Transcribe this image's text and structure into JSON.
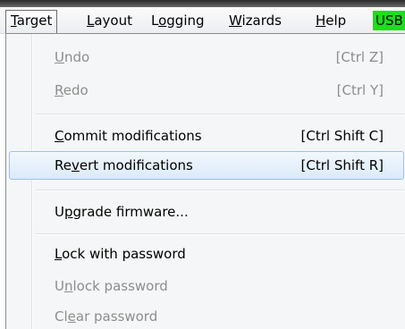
{
  "menubar": {
    "items": [
      {
        "pre": "",
        "mnemonic": "T",
        "post": "arget"
      },
      {
        "pre": "",
        "mnemonic": "L",
        "post": "ayout"
      },
      {
        "pre": "L",
        "mnemonic": "o",
        "post": "gging"
      },
      {
        "pre": "",
        "mnemonic": "W",
        "post": "izards"
      },
      {
        "pre": "",
        "mnemonic": "H",
        "post": "elp"
      }
    ],
    "usb_status": "USB",
    "usb_color": "#17e117"
  },
  "target_menu": {
    "undo": {
      "pre": "",
      "mnemonic": "U",
      "post": "ndo",
      "shortcut": "[Ctrl Z]"
    },
    "redo": {
      "pre": "",
      "mnemonic": "R",
      "post": "edo",
      "shortcut": "[Ctrl Y]"
    },
    "commit": {
      "pre": "",
      "mnemonic": "C",
      "post": "ommit modifications",
      "shortcut": "[Ctrl Shift C]"
    },
    "revert": {
      "pre": "Re",
      "mnemonic": "v",
      "post": "ert modifications",
      "shortcut": "[Ctrl Shift R]"
    },
    "upgrade": {
      "pre": "U",
      "mnemonic": "p",
      "post": "grade firmware..."
    },
    "lock": {
      "pre": "",
      "mnemonic": "L",
      "post": "ock with password"
    },
    "unlock": {
      "pre": "U",
      "mnemonic": "n",
      "post": "lock password"
    },
    "clear": {
      "pre": "Cl",
      "mnemonic": "e",
      "post": "ar password"
    }
  }
}
